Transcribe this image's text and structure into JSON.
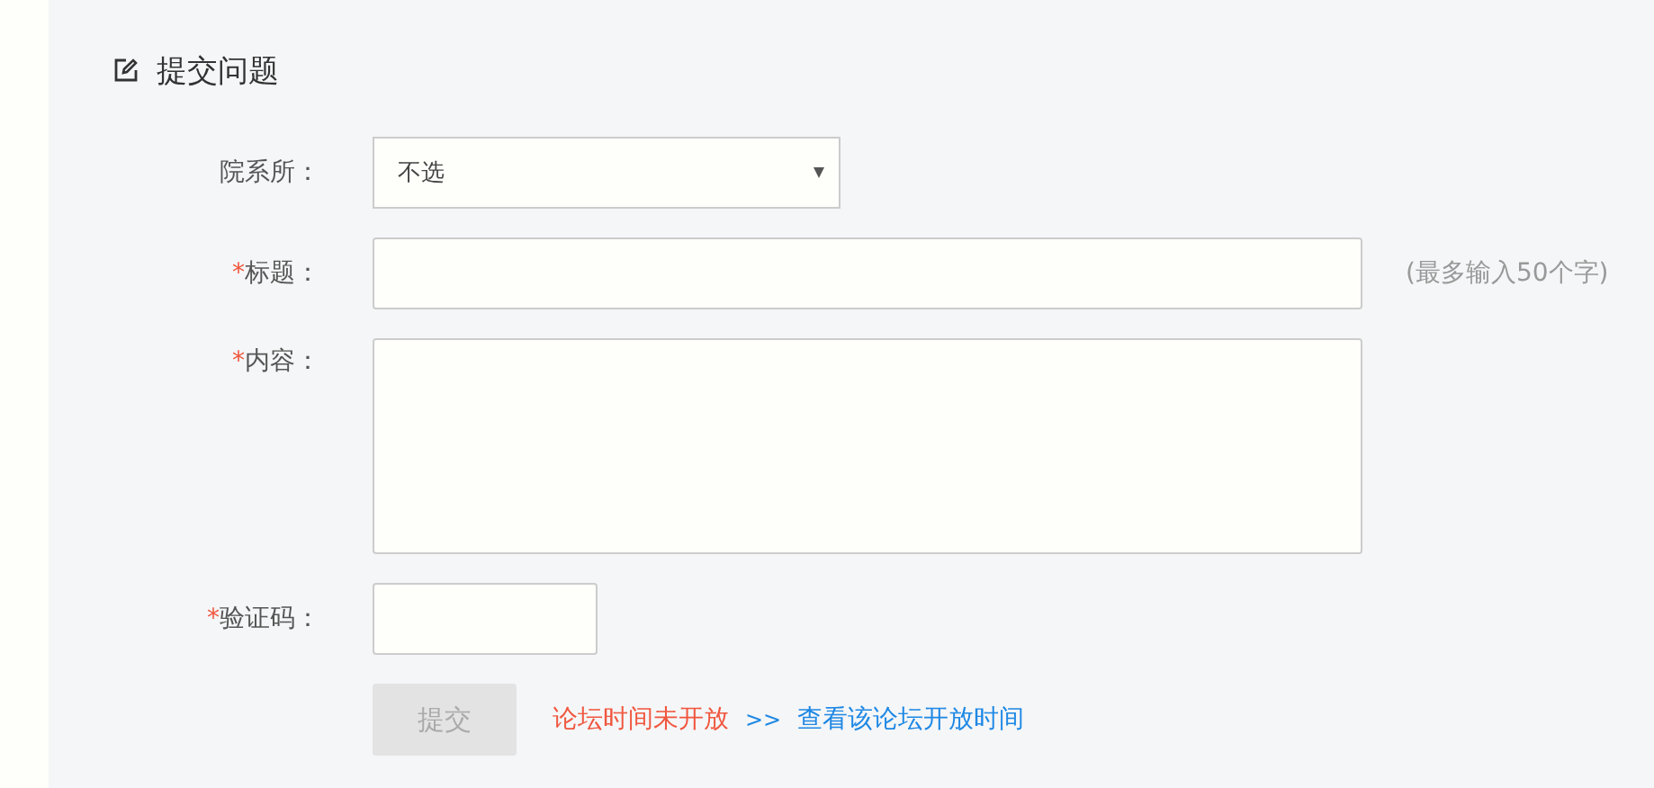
{
  "heading": {
    "title": "提交问题"
  },
  "fields": [
    {
      "kind": "select",
      "label": "院系所：",
      "value": "不选"
    },
    {
      "kind": "text",
      "required_mark": "*",
      "label": "标题：",
      "hint": "(最多输入50个字)"
    },
    {
      "kind": "textarea",
      "required_mark": "*",
      "label": "内容："
    },
    {
      "kind": "captcha",
      "required_mark": "*",
      "label": "验证码："
    }
  ],
  "submit": {
    "label": "提交",
    "disabled": true
  },
  "notice": {
    "message": "论坛时间未开放",
    "separator": ">>",
    "link": "查看该论坛开放时间"
  }
}
